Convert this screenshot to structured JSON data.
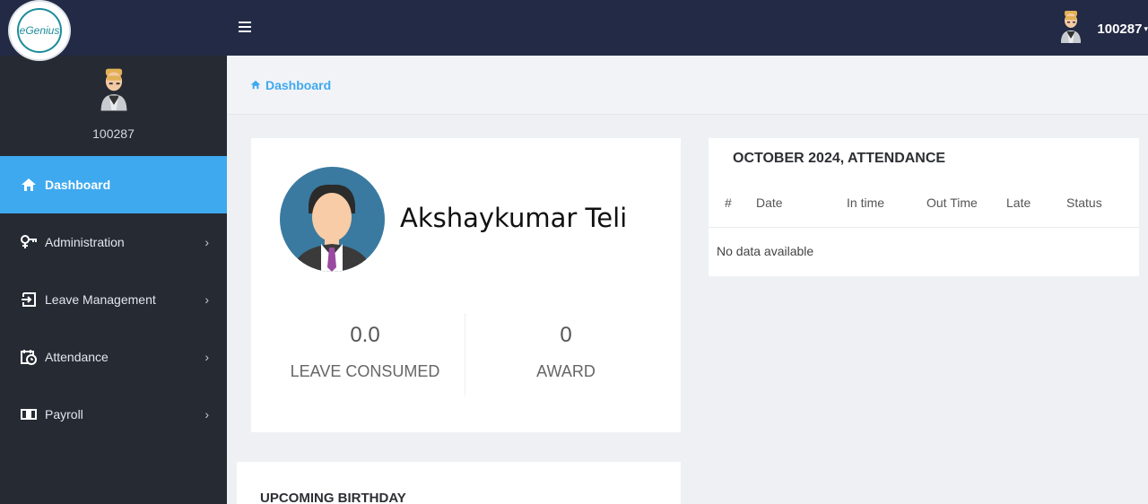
{
  "brand": {
    "logo_text": "eGenius"
  },
  "topbar": {
    "username": "100287",
    "caret": "▾"
  },
  "sidebar": {
    "profile_id": "100287",
    "items": [
      {
        "label": "Dashboard",
        "icon": "home-icon"
      },
      {
        "label": "Administration",
        "icon": "key-icon"
      },
      {
        "label": "Leave Management",
        "icon": "sign-in-icon"
      },
      {
        "label": "Attendance",
        "icon": "calendar-clock-icon"
      },
      {
        "label": "Payroll",
        "icon": "money-icon"
      }
    ]
  },
  "breadcrumb": {
    "label": "Dashboard"
  },
  "profile": {
    "name": "Akshaykumar Teli",
    "leave_value": "0.0",
    "leave_label": "LEAVE CONSUMED",
    "award_value": "0",
    "award_label": "AWARD"
  },
  "attendance": {
    "title": "OCTOBER 2024, ATTENDANCE",
    "columns": [
      "#",
      "Date",
      "In time",
      "Out Time",
      "Late",
      "Status"
    ],
    "empty": "No data available"
  },
  "birthday": {
    "title": "UPCOMING BIRTHDAY"
  },
  "colors": {
    "topbar": "#222a45",
    "sidebar": "#252a33",
    "accent": "#3ea9ef"
  }
}
